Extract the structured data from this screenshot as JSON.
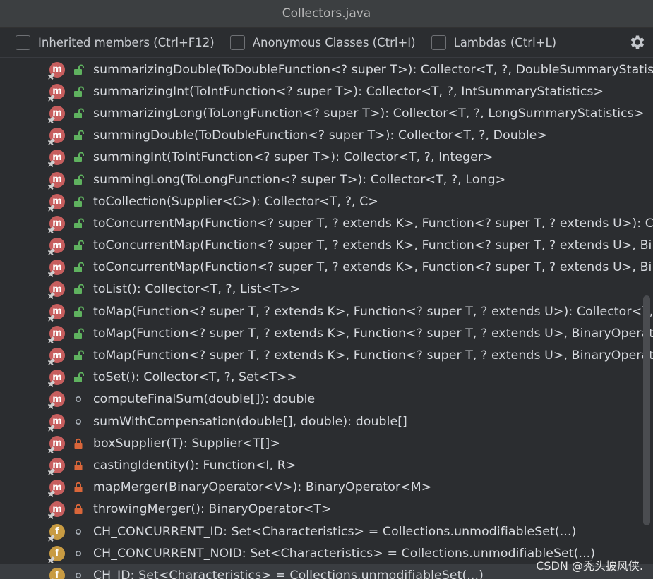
{
  "window": {
    "title": "Collectors.java"
  },
  "toolbar": {
    "inherited_label": "Inherited members (Ctrl+F12)",
    "anonymous_label": "Anonymous Classes (Ctrl+I)",
    "lambdas_label": "Lambdas (Ctrl+L)"
  },
  "colors": {
    "method_icon": "#c75e5e",
    "field_icon": "#c89b42",
    "public_lock": "#5fb25f",
    "private_lock": "#d9663a",
    "package_dot": "#a9b0b8"
  },
  "members": [
    {
      "kind": "method",
      "visibility": "public",
      "text": "summarizingDouble(ToDoubleFunction<? super T>): Collector<T, ?, DoubleSummaryStatistics>"
    },
    {
      "kind": "method",
      "visibility": "public",
      "text": "summarizingInt(ToIntFunction<? super T>): Collector<T, ?, IntSummaryStatistics>"
    },
    {
      "kind": "method",
      "visibility": "public",
      "text": "summarizingLong(ToLongFunction<? super T>): Collector<T, ?, LongSummaryStatistics>"
    },
    {
      "kind": "method",
      "visibility": "public",
      "text": "summingDouble(ToDoubleFunction<? super T>): Collector<T, ?, Double>"
    },
    {
      "kind": "method",
      "visibility": "public",
      "text": "summingInt(ToIntFunction<? super T>): Collector<T, ?, Integer>"
    },
    {
      "kind": "method",
      "visibility": "public",
      "text": "summingLong(ToLongFunction<? super T>): Collector<T, ?, Long>"
    },
    {
      "kind": "method",
      "visibility": "public",
      "text": "toCollection(Supplier<C>): Collector<T, ?, C>"
    },
    {
      "kind": "method",
      "visibility": "public",
      "text": "toConcurrentMap(Function<? super T, ? extends K>, Function<? super T, ? extends U>): Collector"
    },
    {
      "kind": "method",
      "visibility": "public",
      "text": "toConcurrentMap(Function<? super T, ? extends K>, Function<? super T, ? extends U>, BinaryOperator"
    },
    {
      "kind": "method",
      "visibility": "public",
      "text": "toConcurrentMap(Function<? super T, ? extends K>, Function<? super T, ? extends U>, BinaryOperator"
    },
    {
      "kind": "method",
      "visibility": "public",
      "text": "toList(): Collector<T, ?, List<T>>"
    },
    {
      "kind": "method",
      "visibility": "public",
      "text": "toMap(Function<? super T, ? extends K>, Function<? super T, ? extends U>): Collector<T, ?, M"
    },
    {
      "kind": "method",
      "visibility": "public",
      "text": "toMap(Function<? super T, ? extends K>, Function<? super T, ? extends U>, BinaryOperator<"
    },
    {
      "kind": "method",
      "visibility": "public",
      "text": "toMap(Function<? super T, ? extends K>, Function<? super T, ? extends U>, BinaryOperator<"
    },
    {
      "kind": "method",
      "visibility": "public",
      "text": "toSet(): Collector<T, ?, Set<T>>"
    },
    {
      "kind": "method",
      "visibility": "package",
      "text": "computeFinalSum(double[]): double"
    },
    {
      "kind": "method",
      "visibility": "package",
      "text": "sumWithCompensation(double[], double): double[]"
    },
    {
      "kind": "method",
      "visibility": "private",
      "text": "boxSupplier(T): Supplier<T[]>"
    },
    {
      "kind": "method",
      "visibility": "private",
      "text": "castingIdentity(): Function<I, R>"
    },
    {
      "kind": "method",
      "visibility": "private",
      "text": "mapMerger(BinaryOperator<V>): BinaryOperator<M>"
    },
    {
      "kind": "method",
      "visibility": "private",
      "text": "throwingMerger(): BinaryOperator<T>"
    },
    {
      "kind": "field",
      "visibility": "package",
      "text": "CH_CONCURRENT_ID: Set<Characteristics> = Collections.unmodifiableSet(...)"
    },
    {
      "kind": "field",
      "visibility": "package",
      "text": "CH_CONCURRENT_NOID: Set<Characteristics> = Collections.unmodifiableSet(...)"
    },
    {
      "kind": "field",
      "visibility": "package",
      "text": "CH_ID: Set<Characteristics> = Collections.unmodifiableSet(...)"
    }
  ],
  "watermark": "CSDN @秃头披风侠."
}
